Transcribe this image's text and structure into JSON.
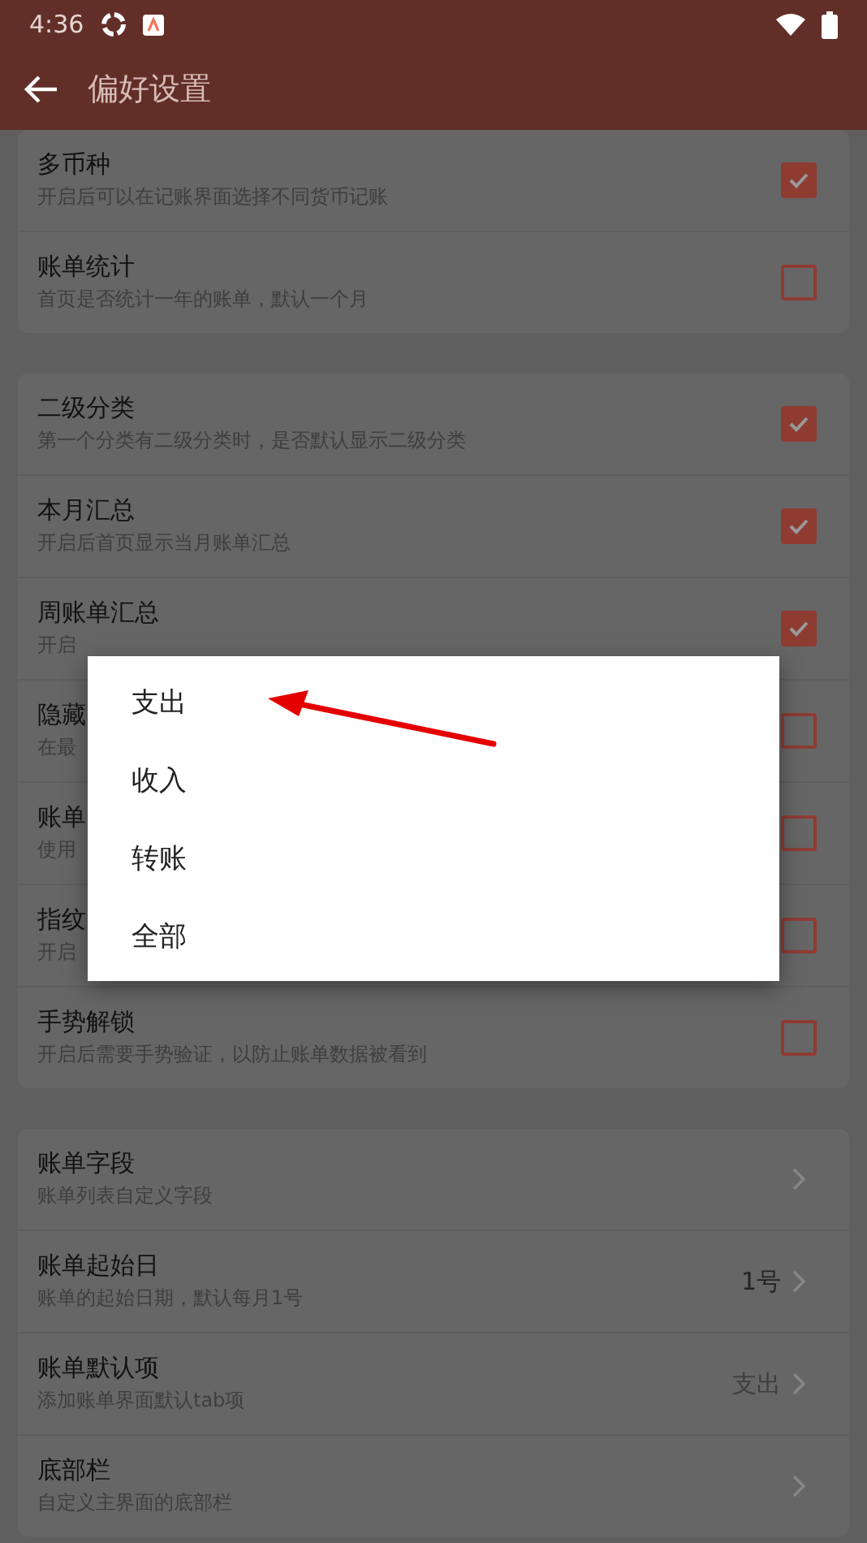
{
  "status_bar": {
    "time": "4:36"
  },
  "app_bar": {
    "title": "偏好设置"
  },
  "sections": [
    {
      "rows": [
        {
          "kind": "checkbox",
          "title": "多币种",
          "subtitle": "开启后可以在记账界面选择不同货币记账",
          "checked": true
        },
        {
          "kind": "checkbox",
          "title": "账单统计",
          "subtitle": "首页是否统计一年的账单，默认一个月",
          "checked": false
        }
      ]
    },
    {
      "rows": [
        {
          "kind": "checkbox",
          "title": "二级分类",
          "subtitle": "第一个分类有二级分类时，是否默认显示二级分类",
          "checked": true
        },
        {
          "kind": "checkbox",
          "title": "本月汇总",
          "subtitle": "开启后首页显示当月账单汇总",
          "checked": true
        },
        {
          "kind": "checkbox",
          "title": "周账单汇总",
          "subtitle": "开启",
          "checked": true
        },
        {
          "kind": "checkbox",
          "title": "隐藏",
          "subtitle": "在最",
          "checked": false
        },
        {
          "kind": "checkbox",
          "title": "账单",
          "subtitle": "使用",
          "checked": false
        },
        {
          "kind": "checkbox",
          "title": "指纹",
          "subtitle": "开启",
          "checked": false
        },
        {
          "kind": "checkbox",
          "title": "手势解锁",
          "subtitle": "开启后需要手势验证，以防止账单数据被看到",
          "checked": false
        }
      ]
    },
    {
      "rows": [
        {
          "kind": "link",
          "title": "账单字段",
          "subtitle": "账单列表自定义字段"
        },
        {
          "kind": "link",
          "title": "账单起始日",
          "subtitle": "账单的起始日期，默认每月1号",
          "value": "1号"
        },
        {
          "kind": "link",
          "title": "账单默认项",
          "subtitle": "添加账单界面默认tab项",
          "value": "支出"
        },
        {
          "kind": "link",
          "title": "底部栏",
          "subtitle": "自定义主界面的底部栏"
        }
      ]
    }
  ],
  "dialog": {
    "options": [
      {
        "label": "支出"
      },
      {
        "label": "收入"
      },
      {
        "label": "转账"
      },
      {
        "label": "全部"
      }
    ]
  }
}
